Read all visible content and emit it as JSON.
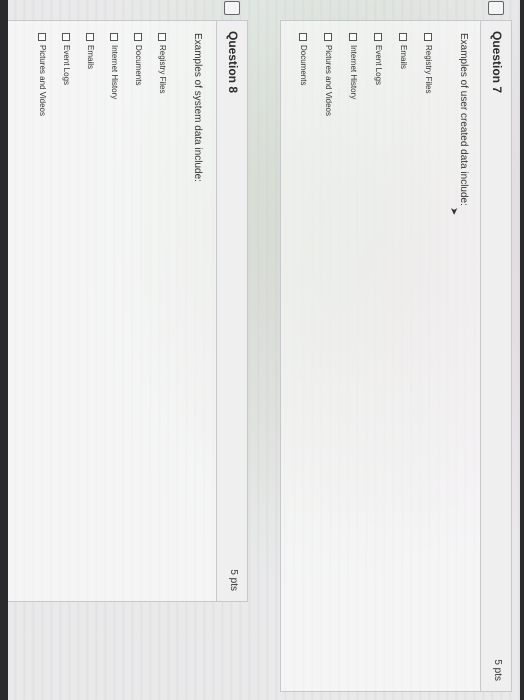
{
  "question7": {
    "title": "Question 7",
    "points": "5 pts",
    "prompt": "Examples of user created data include:",
    "options": [
      "Registry Files",
      "Emails",
      "Event Logs",
      "Internet History",
      "Pictures and Videos",
      "Documents"
    ]
  },
  "question8": {
    "title": "Question 8",
    "points": "5 pts",
    "prompt": "Examples of system data include:",
    "options": [
      "Registry Files",
      "Documents",
      "Internet History",
      "Emails",
      "Event Logs",
      "Pictures and Videos"
    ]
  }
}
